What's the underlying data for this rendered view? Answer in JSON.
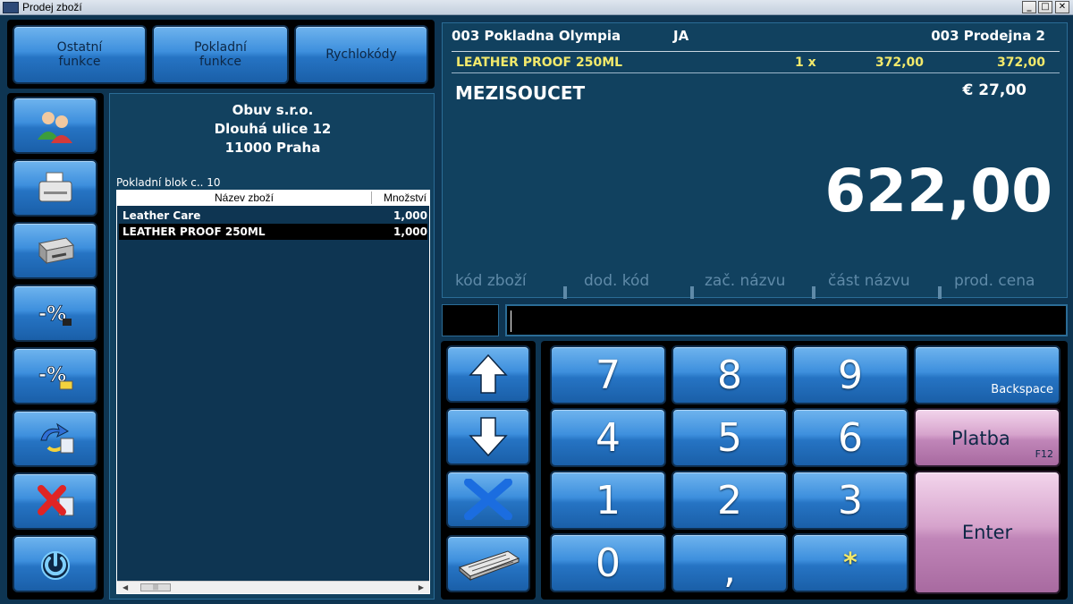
{
  "window": {
    "title": "Prodej zboží"
  },
  "top_buttons": [
    {
      "line1": "Ostatní",
      "line2": "funkce"
    },
    {
      "line1": "Pokladní",
      "line2": "funkce"
    },
    {
      "line1": "Rychlokódy",
      "line2": ""
    }
  ],
  "side_buttons": [
    "users-icon",
    "receipt-printer-icon",
    "cash-drawer-icon",
    "discount-item-icon",
    "discount-total-icon",
    "return-goods-icon",
    "cancel-receipt-icon",
    "power-icon"
  ],
  "receipt": {
    "shop_name": "Obuv s.r.o.",
    "street": "Dlouhá ulice 12",
    "city": "11000 Praha",
    "block_label": "Pokladní blok c.. 10",
    "col_name": "Název zboží",
    "col_qty": "Množství",
    "rows": [
      {
        "name": "Leather Care",
        "qty": "1,000"
      },
      {
        "name": "LEATHER PROOF 250ML",
        "qty": "1,000"
      }
    ]
  },
  "display": {
    "register": "003 Pokladna Olympia",
    "user": "JA",
    "store": "003 Prodejna 2",
    "item": {
      "name": "LEATHER PROOF 250ML",
      "qty": "1 x",
      "price": "372,00",
      "total": "372,00"
    },
    "subtotal_label": "MEZISOUCET",
    "subtotal_eur": "€ 27,00",
    "total": "622,00",
    "modes": [
      "kód zboží",
      "dod. kód",
      "zač. názvu",
      "část názvu",
      "prod. cena"
    ]
  },
  "keypad": {
    "keys": [
      "7",
      "8",
      "9",
      "4",
      "5",
      "6",
      "1",
      "2",
      "3",
      "0",
      ",",
      "*"
    ],
    "backspace": "Backspace",
    "platba": "Platba",
    "platba_hint": "F12",
    "enter": "Enter"
  },
  "colors": {
    "highlight_line": "#f3e96b",
    "mode_text": "#5f8aa8",
    "panel_bg": "#11415f"
  }
}
